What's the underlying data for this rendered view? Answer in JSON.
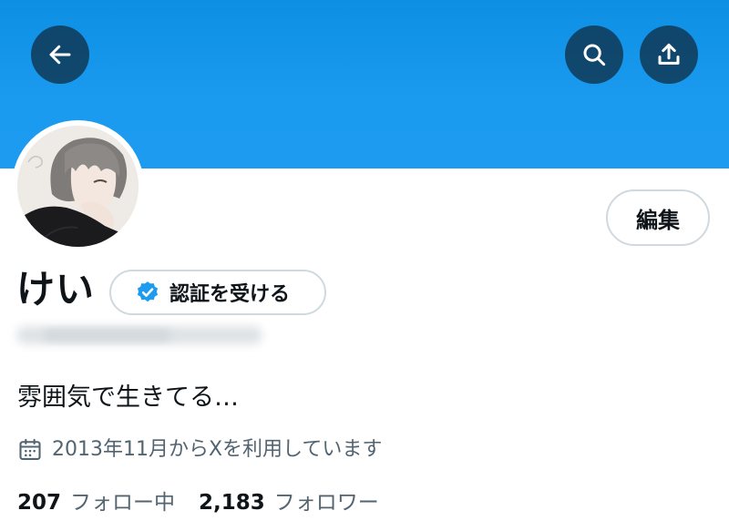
{
  "header": {
    "back_icon": "arrow-left-icon",
    "search_icon": "search-icon",
    "share_icon": "share-icon",
    "banner_color": "#1d9bf0"
  },
  "profile": {
    "display_name": "けい",
    "verify_label": "認証を受ける",
    "verify_icon": "verified-badge-icon",
    "edit_label": "編集",
    "bio": "雰囲気で生きてる…",
    "joined_text": "2013年11月からXを利用しています",
    "joined_icon": "calendar-icon"
  },
  "stats": {
    "following_count": "207",
    "following_label": "フォロー中",
    "followers_count": "2,183",
    "followers_label": "フォロワー"
  },
  "colors": {
    "accent": "#1d9bf0",
    "text_primary": "#0f1419",
    "text_secondary": "#536471",
    "border": "#cfd9de"
  }
}
